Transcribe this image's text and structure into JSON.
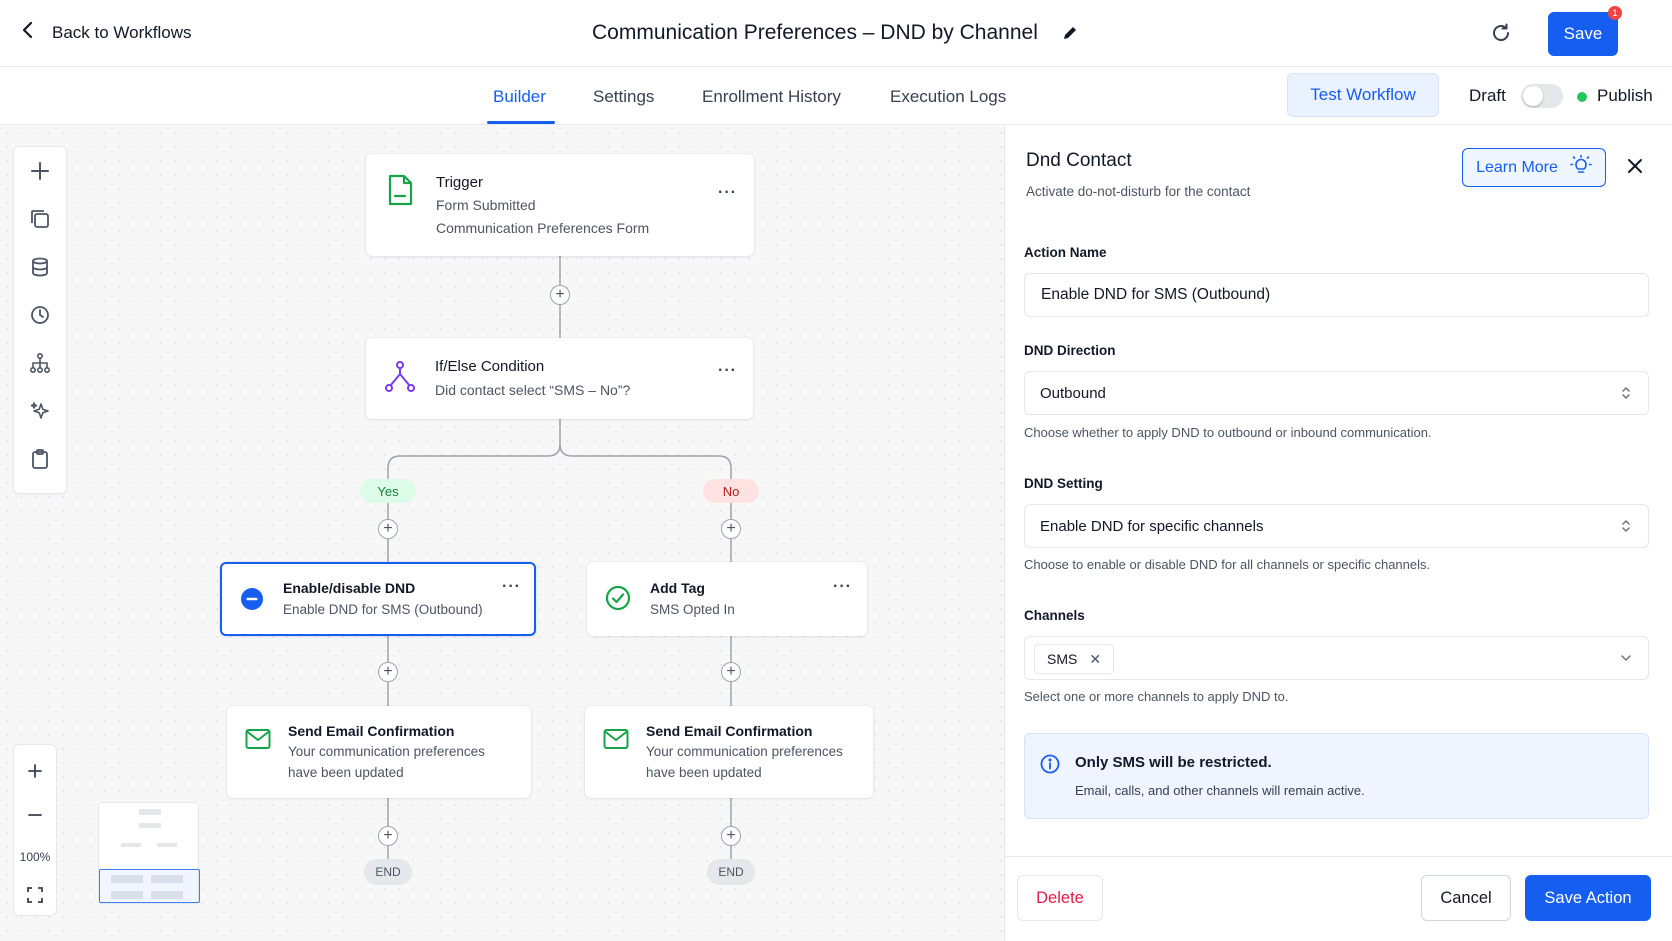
{
  "header": {
    "back_label": "Back to Workflows",
    "workflow_title": "Communication Preferences – DND by Channel",
    "save_label": "Save",
    "save_badge_count": "1"
  },
  "tabs": [
    {
      "label": "Builder",
      "active": true
    },
    {
      "label": "Settings",
      "active": false
    },
    {
      "label": "Enrollment History",
      "active": false
    },
    {
      "label": "Execution Logs",
      "active": false
    }
  ],
  "toolbar_right": {
    "test_label": "Test Workflow",
    "draft_label": "Draft",
    "publish_label": "Publish",
    "toggle_on": false
  },
  "canvas": {
    "tools": [
      "plus-icon",
      "copy-icon",
      "database-icon",
      "clock-icon",
      "hierarchy-icon",
      "sparkles-icon",
      "clipboard-icon"
    ],
    "zoom_level": "100%",
    "trigger": {
      "title": "Trigger",
      "line1": "Form Submitted",
      "line2": "Communication Preferences Form"
    },
    "condition": {
      "title": "If/Else Condition",
      "subtitle": "Did contact select “SMS – No”?"
    },
    "branch_yes": "Yes",
    "branch_no": "No",
    "dnd_action": {
      "title": "Enable/disable DND",
      "subtitle": "Enable DND for SMS (Outbound)"
    },
    "add_tag": {
      "title": "Add Tag",
      "subtitle": "SMS Opted In"
    },
    "email_left": {
      "title": "Send Email Confirmation",
      "line1": "Your communication preferences",
      "line2": "have been updated"
    },
    "email_right": {
      "title": "Send Email Confirmation",
      "line1": "Your communication preferences",
      "line2": "have been updated"
    },
    "end_label": "END",
    "more_label": "···",
    "plus_label": "+"
  },
  "panel": {
    "title": "Dnd Contact",
    "description": "Activate do-not-disturb for the contact",
    "learn_more_label": "Learn More",
    "action_name_label": "Action Name",
    "action_name_value": "Enable DND for SMS (Outbound)",
    "direction_label": "DND Direction",
    "direction_value": "Outbound",
    "direction_help": "Choose whether to apply DND to outbound or inbound communication.",
    "setting_label": "DND Setting",
    "setting_value": "Enable DND for specific channels",
    "setting_help": "Choose to enable or disable DND for all channels or specific channels.",
    "channels_label": "Channels",
    "channels_selected": [
      "SMS"
    ],
    "channels_help": "Select one or more channels to apply DND to.",
    "info_title": "Only SMS will be restricted.",
    "info_text": "Email, calls, and other channels will remain active.",
    "delete_label": "Delete",
    "cancel_label": "Cancel",
    "save_action_label": "Save Action"
  },
  "colors": {
    "primary": "#155eef",
    "success": "#22c55e",
    "danger": "#e11d48"
  }
}
